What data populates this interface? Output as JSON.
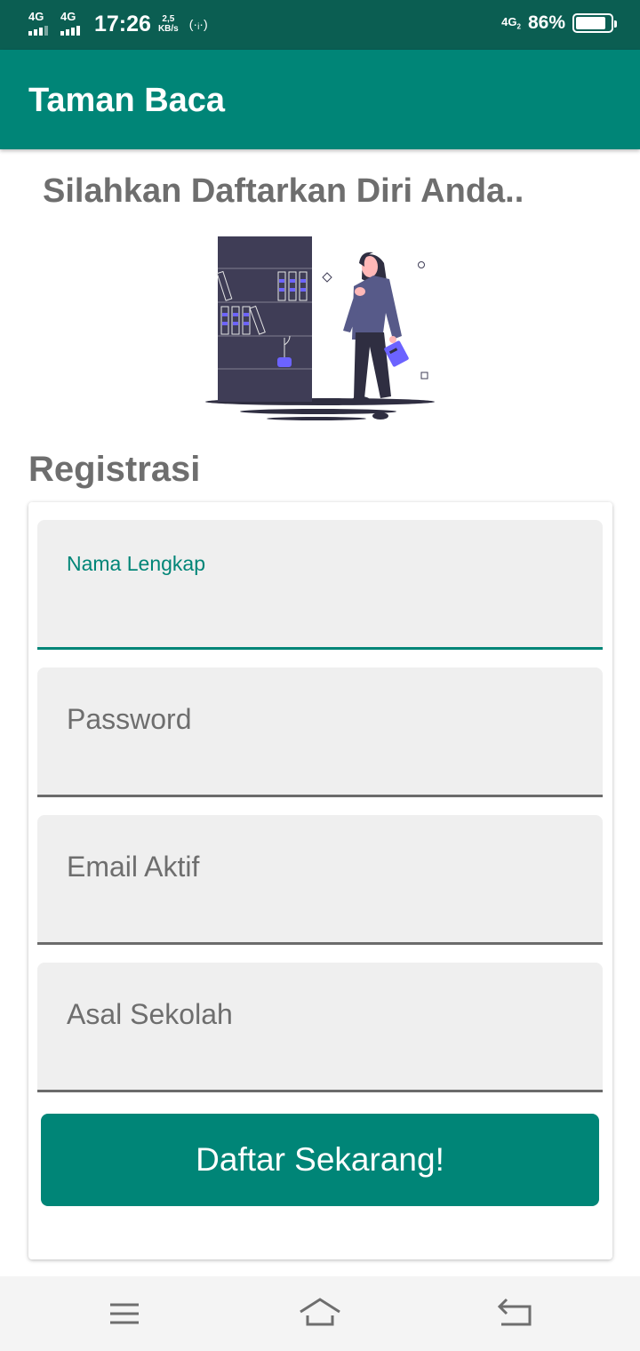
{
  "status_bar": {
    "network_1": "4G",
    "network_2": "4G",
    "time": "17:26",
    "speed_value": "2,5",
    "speed_unit": "KB/s",
    "volte": "4G",
    "battery_percent": "86%",
    "battery_level": 0.86
  },
  "app_bar": {
    "title": "Taman Baca"
  },
  "main": {
    "greeting": "Silahkan Daftarkan Diri Anda..",
    "section_title": "Registrasi"
  },
  "form": {
    "fields": [
      {
        "label": "Nama Lengkap",
        "value": "",
        "focused": true
      },
      {
        "label": "Password",
        "value": ""
      },
      {
        "label": "Email Aktif",
        "value": ""
      },
      {
        "label": "Asal Sekolah",
        "value": ""
      }
    ],
    "submit_label": "Daftar Sekarang!"
  },
  "nav_bar": {
    "icons": [
      "menu-icon",
      "home-icon",
      "back-icon"
    ]
  },
  "colors": {
    "primary": "#008577",
    "status_bar": "#0b5e52",
    "text_gray": "#6e6e6e",
    "field_bg": "#efefef",
    "illustration_accent": "#6c63ff"
  }
}
